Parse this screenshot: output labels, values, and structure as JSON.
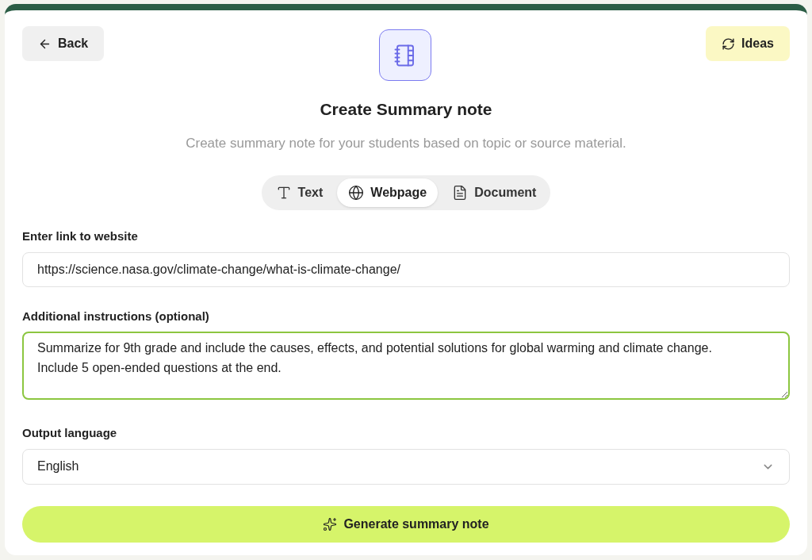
{
  "back_button": {
    "label": "Back"
  },
  "ideas_button": {
    "label": "Ideas"
  },
  "title": "Create Summary note",
  "subtitle": "Create summary note for your students based on topic or source material.",
  "tabs": [
    {
      "label": "Text",
      "kind": "text",
      "selected": false
    },
    {
      "label": "Webpage",
      "kind": "webpage",
      "selected": true
    },
    {
      "label": "Document",
      "kind": "document",
      "selected": false
    }
  ],
  "link_field": {
    "label": "Enter link to website",
    "value": "https://science.nasa.gov/climate-change/what-is-climate-change/"
  },
  "instructions_field": {
    "label": "Additional instructions (optional)",
    "value": "Summarize for 9th grade and include the causes, effects, and potential solutions for global warming and climate change.\nInclude 5 open-ended questions at the end.",
    "focused": true
  },
  "language_field": {
    "label": "Output language",
    "value": "English"
  },
  "generate_button": {
    "label": "Generate summary note"
  }
}
